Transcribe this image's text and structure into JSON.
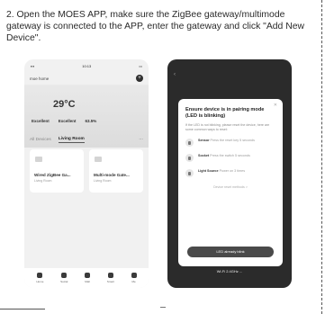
{
  "instruction": "2. Open the MOES APP, make sure the ZigBee gateway/multimode gateway is connected to the APP, enter the gateway and click \"Add New Device\".",
  "left_phone": {
    "status_time": "10:13",
    "home_title": "moe home",
    "temperature": "29°C",
    "weather": [
      {
        "label": "Excellent"
      },
      {
        "label": "Excellent"
      },
      {
        "label": "63.5%"
      }
    ],
    "tabs": {
      "all": "All Devices",
      "active": "Living Room",
      "more": "···"
    },
    "cards": [
      {
        "title": "Wired ZigBee Ga...",
        "sub": "Living Room"
      },
      {
        "title": "Multi-mode Gate...",
        "sub": "Living Room"
      }
    ],
    "tabbar": [
      "Home",
      "Social",
      "Mall",
      "Smart",
      "Me"
    ]
  },
  "right_phone": {
    "modal_title": "Ensure device is in pairing mode (LED is blinking)",
    "modal_sub": "If the LED is not blinking, please reset the device, here are some common ways to reset:",
    "devices": [
      {
        "name": "Sensor",
        "desc": "Press the reset key 5 seconds"
      },
      {
        "name": "Socket",
        "desc": "Press the switch 5 seconds"
      },
      {
        "name": "Light Source",
        "desc": "Power on 3 times"
      }
    ],
    "link_text": "Device reset methods >",
    "button": "LED already blink",
    "footer": "Wi-Fi 2.4GHz ..."
  }
}
